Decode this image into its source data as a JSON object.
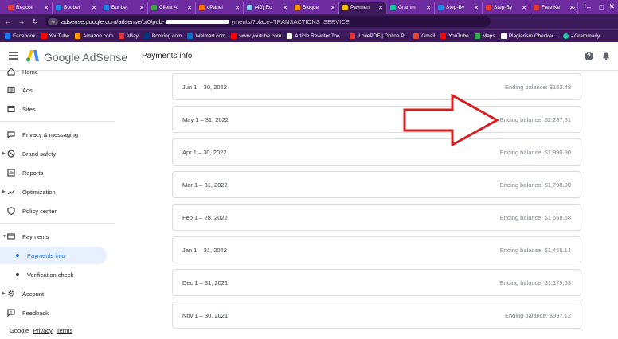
{
  "browser": {
    "tabs": [
      {
        "label": "Regcoll",
        "color": "#e53935"
      },
      {
        "label": "But bet",
        "color": "#1e88e5"
      },
      {
        "label": "But bet",
        "color": "#1e88e5"
      },
      {
        "label": "Client A",
        "color": "#43a047"
      },
      {
        "label": "cPanel",
        "color": "#ff6f00"
      },
      {
        "label": "(40) Ro",
        "color": "#90caf9"
      },
      {
        "label": "Blogge",
        "color": "#ff9800"
      },
      {
        "label": "Paymen",
        "color": "#fbbc04"
      },
      {
        "label": "Gramm",
        "color": "#15c39a"
      },
      {
        "label": "Step-By",
        "color": "#1e88e5"
      },
      {
        "label": "Step-By",
        "color": "#e53935"
      },
      {
        "label": "Free Ke",
        "color": "#e53935"
      }
    ],
    "url_prefix": "adsense.google.com/adsense/u/0/pub-",
    "url_suffix": "yments/?place=TRANSACTIONS_SERVICE",
    "bookmarks": [
      {
        "label": "Facebook",
        "color": "#1877f2"
      },
      {
        "label": "YouTube",
        "color": "#ff0000"
      },
      {
        "label": "Amazon.com",
        "color": "#ff9900"
      },
      {
        "label": "eBay",
        "color": "#e53238"
      },
      {
        "label": "Booking.com",
        "color": "#003580"
      },
      {
        "label": "Walmart.com",
        "color": "#0071ce"
      },
      {
        "label": "www.youtube.com",
        "color": "#ff0000"
      },
      {
        "label": "Article Rewriter Too...",
        "color": "#ffffff"
      },
      {
        "label": "iLovePDF | Online P...",
        "color": "#e5322d"
      },
      {
        "label": "Gmail",
        "color": "#ea4335"
      },
      {
        "label": "YouTube",
        "color": "#ff0000"
      },
      {
        "label": "Maps",
        "color": "#34a853"
      },
      {
        "label": "Plagiarism Checker...",
        "color": "#ffffff"
      },
      {
        "label": "- Grammarly",
        "color": "#15c39a"
      }
    ]
  },
  "header": {
    "brand": "Google AdSense",
    "page_title": "Payments info"
  },
  "sidebar": {
    "items": [
      {
        "label": "Home",
        "icon": "home-icon"
      },
      {
        "label": "Ads",
        "icon": "ads-icon"
      },
      {
        "label": "Sites",
        "icon": "sites-icon"
      },
      {
        "label": "Privacy & messaging",
        "icon": "privacy-icon"
      },
      {
        "label": "Brand safety",
        "icon": "block-icon"
      },
      {
        "label": "Reports",
        "icon": "reports-icon"
      },
      {
        "label": "Optimization",
        "icon": "trending-icon"
      },
      {
        "label": "Policy center",
        "icon": "shield-icon"
      },
      {
        "label": "Payments",
        "icon": "payments-icon"
      },
      {
        "label": "Payments info",
        "icon": "dot"
      },
      {
        "label": "Verification check",
        "icon": "dot"
      },
      {
        "label": "Account",
        "icon": "settings-icon"
      },
      {
        "label": "Feedback",
        "icon": "feedback-icon"
      }
    ],
    "footer": {
      "google": "Google",
      "privacy": "Privacy",
      "terms": "Terms"
    }
  },
  "payments": [
    {
      "period": "Jun 1 – 30, 2022",
      "balance": "Ending balance: $162.48"
    },
    {
      "period": "May 1 – 31, 2022",
      "balance": "Ending balance: $2,287.61"
    },
    {
      "period": "Apr 1 – 30, 2022",
      "balance": "Ending balance: $1,990.90"
    },
    {
      "period": "Mar 1 – 31, 2022",
      "balance": "Ending balance: $1,798.90"
    },
    {
      "period": "Feb 1 – 28, 2022",
      "balance": "Ending balance: $1,658.58"
    },
    {
      "period": "Jan 1 – 31, 2022",
      "balance": "Ending balance: $1,455.14"
    },
    {
      "period": "Dec 1 – 31, 2021",
      "balance": "Ending balance: $1,179.63"
    },
    {
      "period": "Nov 1 – 30, 2021",
      "balance": "Ending balance: $997.12"
    }
  ],
  "colors": {
    "browser_chrome": "#6f2ba0",
    "accent": "#1a73e8",
    "annotation_arrow": "#d81e1e"
  }
}
